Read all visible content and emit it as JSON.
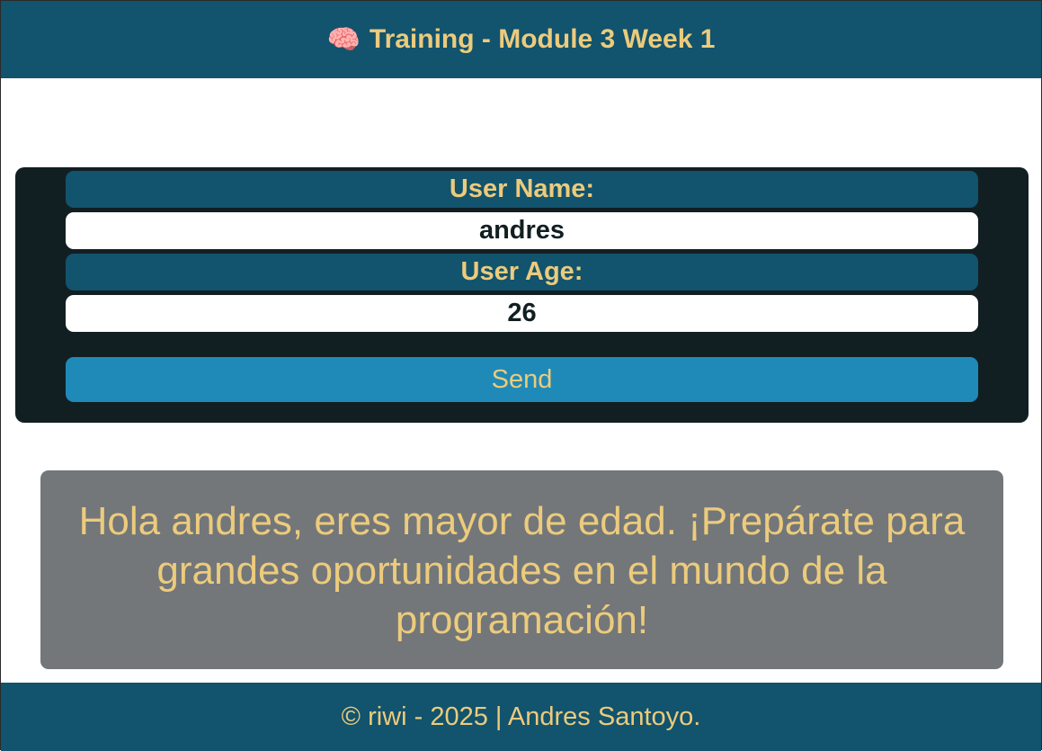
{
  "header": {
    "icon": "brain-icon",
    "icon_glyph": "🧠",
    "title": "Training - Module 3 Week 1"
  },
  "form": {
    "name_label": "User Name:",
    "name_value": "andres",
    "age_label": "User Age:",
    "age_value": "26",
    "send_label": "Send"
  },
  "message": {
    "text": "Hola andres, eres mayor de edad. ¡Prepárate para grandes oportunidades en el mundo de la programación!"
  },
  "footer": {
    "text": "© riwi - 2025 | Andres Santoyo."
  },
  "colors": {
    "primary": "#12536d",
    "accent": "#eccb7c",
    "card_bg": "#121f22",
    "button": "#1f8ab8",
    "message_bg": "#73777a"
  }
}
